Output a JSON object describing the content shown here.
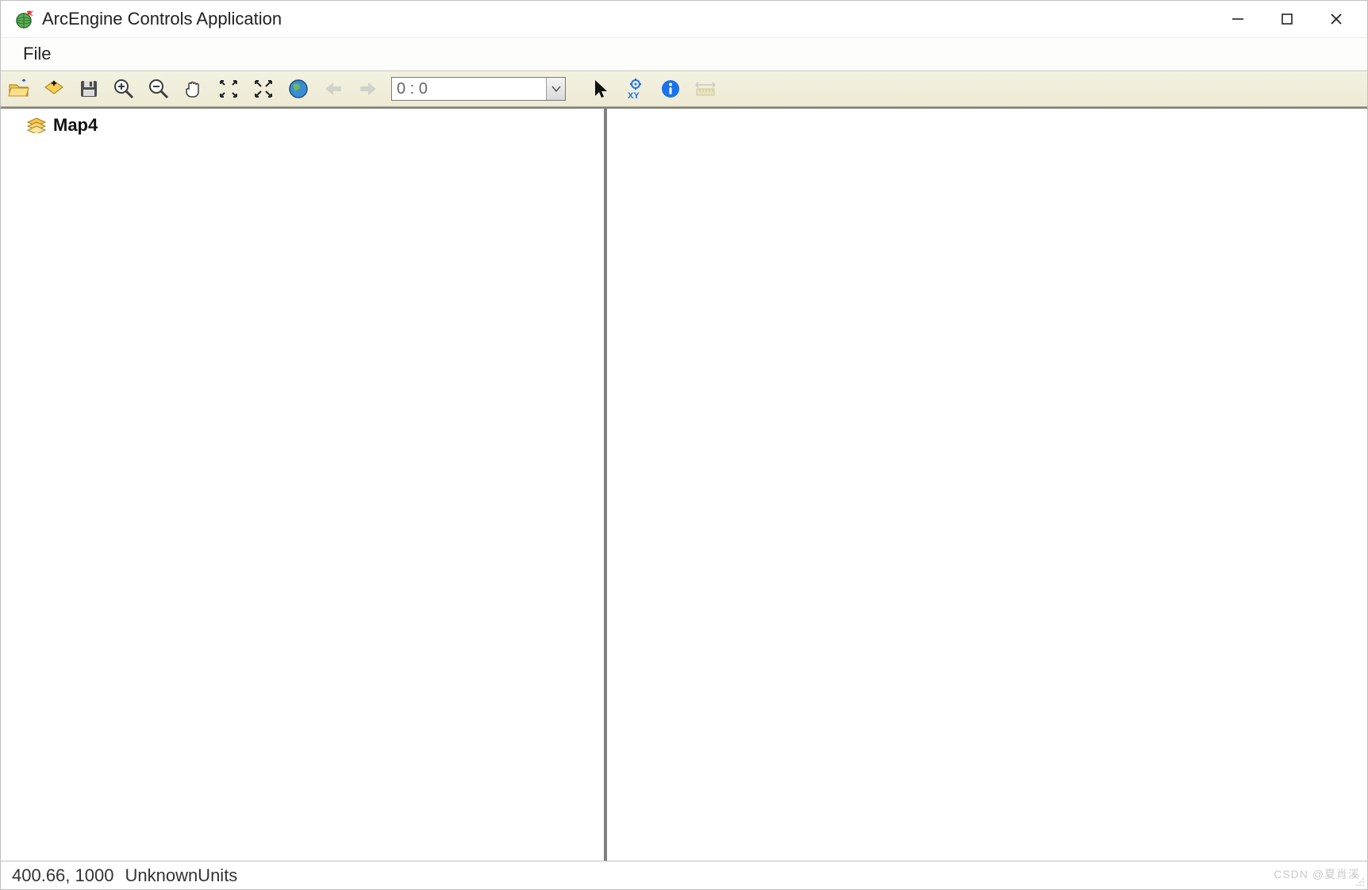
{
  "window": {
    "title": "ArcEngine Controls Application"
  },
  "menubar": {
    "items": [
      "File"
    ]
  },
  "toolbar": {
    "icons": {
      "open": "open-folder-icon",
      "add_data": "add-data-icon",
      "save": "save-icon",
      "zoom_in": "zoom-in-icon",
      "zoom_out": "zoom-out-icon",
      "pan": "pan-hand-icon",
      "fixed_zoom_in": "fixed-zoom-in-icon",
      "full_extent_arrows": "full-extent-arrows-icon",
      "globe": "globe-icon",
      "back": "arrow-left-icon",
      "forward": "arrow-right-icon",
      "select": "pointer-icon",
      "goto_xy": "goto-xy-icon",
      "identify": "identify-icon",
      "measure": "measure-icon"
    },
    "scale_value": "0 : 0"
  },
  "toc": {
    "items": [
      {
        "label": "Map4",
        "icon": "layers-icon"
      }
    ]
  },
  "statusbar": {
    "coords": "400.66, 1000",
    "units": "UnknownUnits"
  },
  "watermark": "CSDN @夏肖溪"
}
